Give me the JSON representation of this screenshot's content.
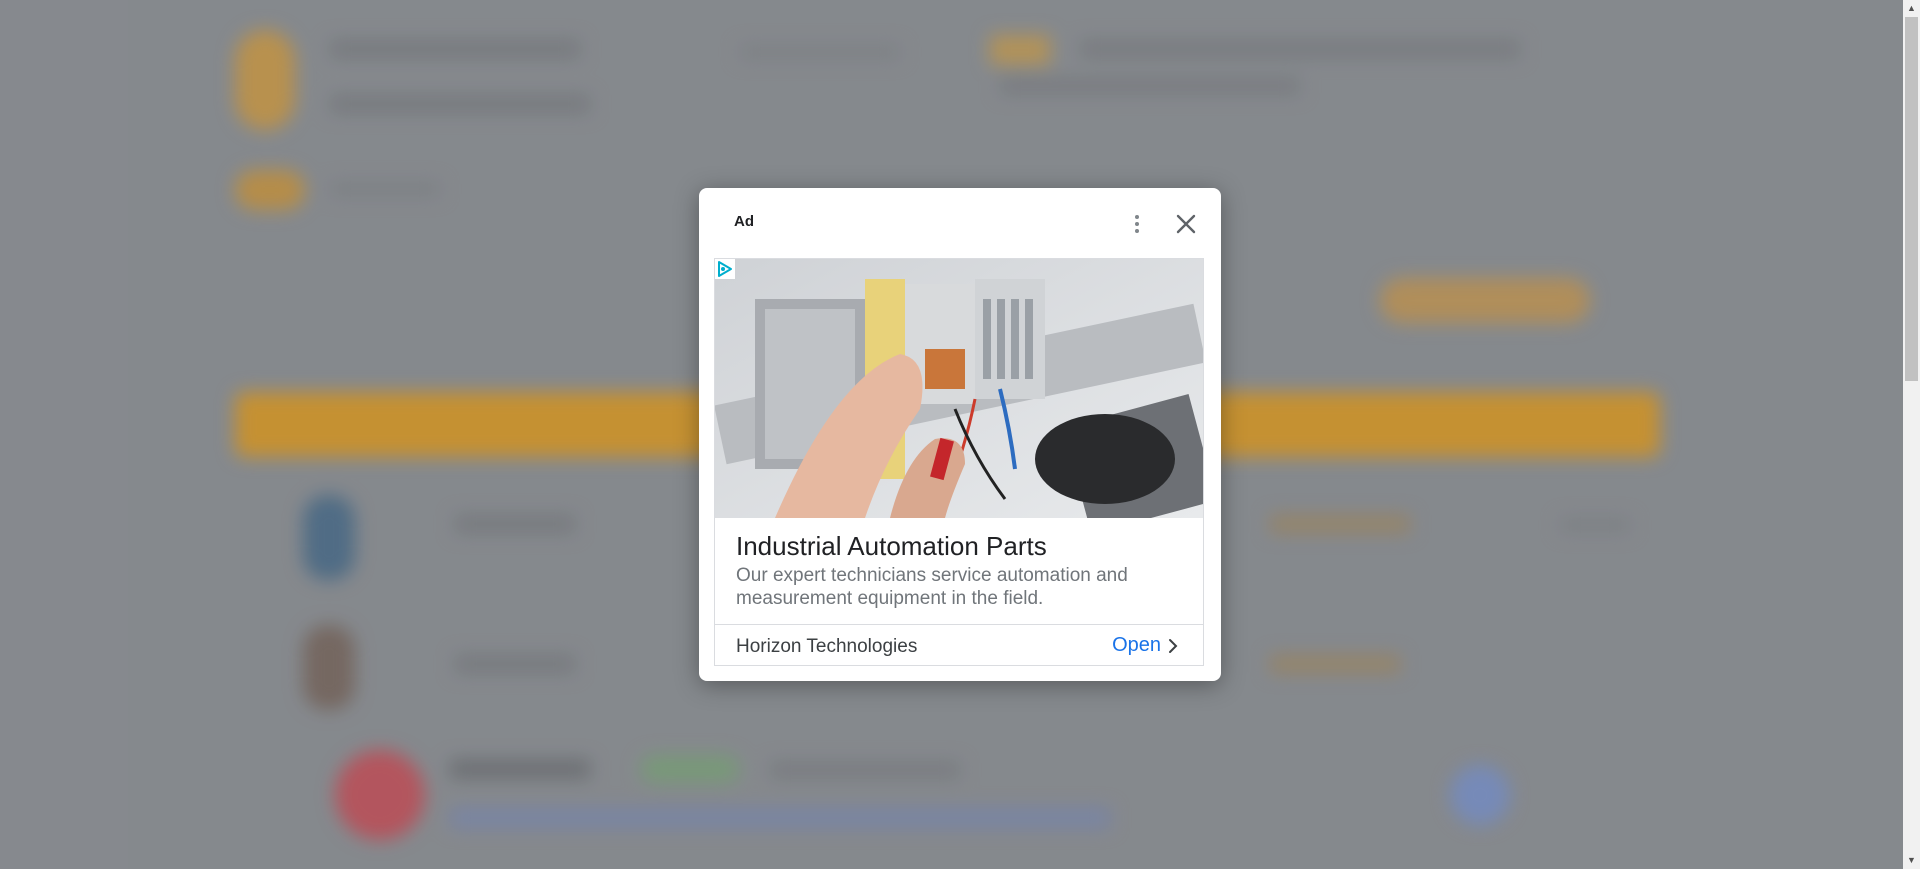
{
  "modal": {
    "ad_label": "Ad",
    "menu_icon": "more-vert-icon",
    "close_icon": "close-icon",
    "adchoices_icon": "adchoices-icon",
    "title": "Industrial Automation Parts",
    "description": "Our expert technicians service automation and measurement equipment in the field.",
    "advertiser": "Horizon Technologies",
    "cta_label": "Open",
    "cta_icon": "chevron-right-icon",
    "cta_color": "#1a73e8"
  },
  "colors": {
    "backdrop": "#8e9196",
    "banner_accent": "#d99a2b"
  }
}
